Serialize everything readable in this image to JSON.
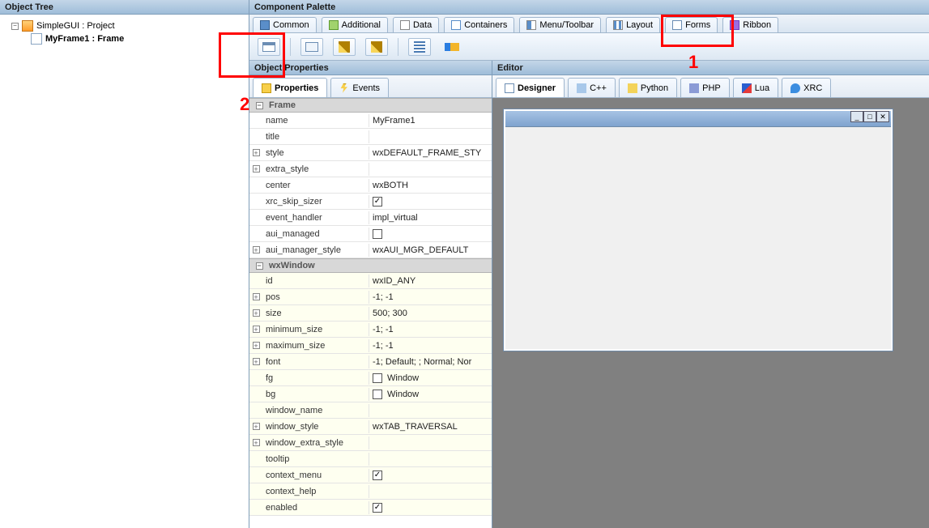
{
  "object_tree": {
    "header": "Object Tree",
    "root_label": "SimpleGUI : Project",
    "child_label": "MyFrame1 : Frame"
  },
  "palette": {
    "header": "Component Palette",
    "tabs": [
      {
        "label": "Common"
      },
      {
        "label": "Additional"
      },
      {
        "label": "Data"
      },
      {
        "label": "Containers"
      },
      {
        "label": "Menu/Toolbar"
      },
      {
        "label": "Layout"
      },
      {
        "label": "Forms"
      },
      {
        "label": "Ribbon"
      }
    ]
  },
  "object_properties": {
    "header": "Object Properties",
    "tabs": {
      "properties": "Properties",
      "events": "Events"
    },
    "sections": {
      "frame": "Frame",
      "wxwindow": "wxWindow"
    },
    "frame_props": {
      "name": {
        "k": "name",
        "v": "MyFrame1"
      },
      "title": {
        "k": "title",
        "v": ""
      },
      "style": {
        "k": "style",
        "v": "wxDEFAULT_FRAME_STY"
      },
      "extra_style": {
        "k": "extra_style",
        "v": ""
      },
      "center": {
        "k": "center",
        "v": "wxBOTH"
      },
      "xrc_skip_sizer": {
        "k": "xrc_skip_sizer",
        "checked": true
      },
      "event_handler": {
        "k": "event_handler",
        "v": "impl_virtual"
      },
      "aui_managed": {
        "k": "aui_managed",
        "checked": false
      },
      "aui_manager_style": {
        "k": "aui_manager_style",
        "v": "wxAUI_MGR_DEFAULT"
      }
    },
    "wxwindow_props": {
      "id": {
        "k": "id",
        "v": "wxID_ANY"
      },
      "pos": {
        "k": "pos",
        "v": "-1; -1"
      },
      "size": {
        "k": "size",
        "v": "500; 300"
      },
      "minimum_size": {
        "k": "minimum_size",
        "v": "-1; -1"
      },
      "maximum_size": {
        "k": "maximum_size",
        "v": "-1; -1"
      },
      "font": {
        "k": "font",
        "v": "-1; Default; ; Normal; Nor"
      },
      "fg": {
        "k": "fg",
        "v": "Window"
      },
      "bg": {
        "k": "bg",
        "v": "Window"
      },
      "window_name": {
        "k": "window_name",
        "v": ""
      },
      "window_style": {
        "k": "window_style",
        "v": "wxTAB_TRAVERSAL"
      },
      "window_extra_style": {
        "k": "window_extra_style",
        "v": ""
      },
      "tooltip": {
        "k": "tooltip",
        "v": ""
      },
      "context_menu": {
        "k": "context_menu",
        "checked": true
      },
      "context_help": {
        "k": "context_help",
        "v": ""
      },
      "enabled": {
        "k": "enabled",
        "checked": true
      }
    }
  },
  "editor": {
    "header": "Editor",
    "tabs": {
      "designer": "Designer",
      "cpp": "C++",
      "python": "Python",
      "php": "PHP",
      "lua": "Lua",
      "xrc": "XRC"
    },
    "win_min": "_",
    "win_max": "□",
    "win_close": "✕"
  },
  "annotations": {
    "one": "1",
    "two": "2"
  }
}
